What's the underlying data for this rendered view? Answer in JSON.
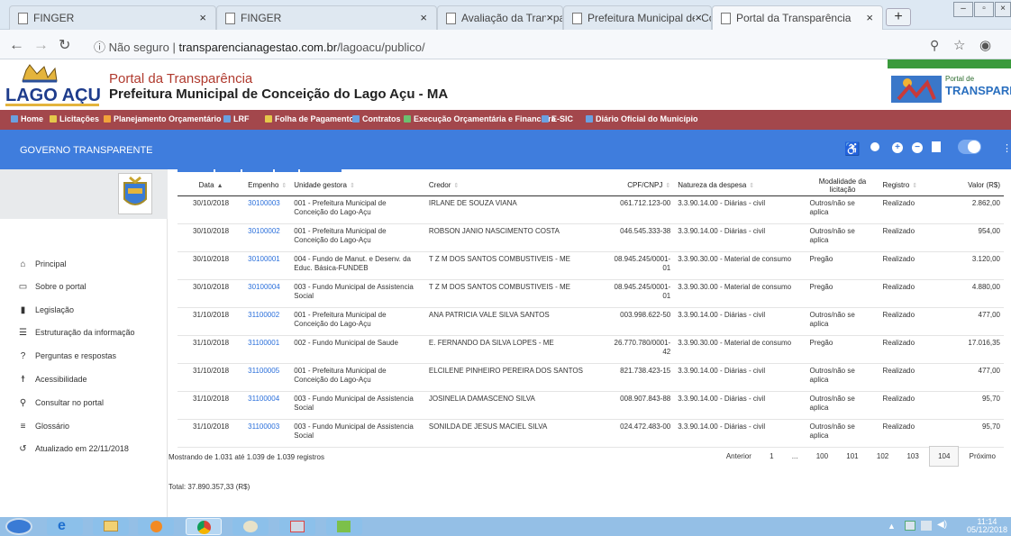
{
  "browser": {
    "tabs": [
      {
        "title": "FINGER"
      },
      {
        "title": "FINGER"
      },
      {
        "title": "Avaliação da Transparência dos"
      },
      {
        "title": "Prefeitura Municipal de Concei"
      },
      {
        "title": "Portal da Transparência"
      }
    ],
    "security": "Não seguro",
    "url_host": "transparencianagestao.com.br",
    "url_path": "/lagoacu/publico/"
  },
  "header": {
    "logo_text": "LAGO AÇU",
    "title": "Portal da Transparência",
    "subtitle": "Prefeitura Municipal de Conceição do Lago Açu - MA",
    "right_logo_small": "Portal de",
    "right_logo_big": "TRANSPARÊNC"
  },
  "menu": [
    {
      "label": "Home",
      "color": "#6aa0e0"
    },
    {
      "label": "Licitações",
      "color": "#e5c84a"
    },
    {
      "label": "Planejamento Orçamentário",
      "color": "#f2a33a"
    },
    {
      "label": "LRF",
      "color": "#6aa0e0"
    },
    {
      "label": "Folha de Pagamento",
      "color": "#e5c84a"
    },
    {
      "label": "Contratos",
      "color": "#6aa0e0"
    },
    {
      "label": "Execução Orçamentária e Financeira",
      "color": "#6cc070"
    },
    {
      "label": "E-SIC",
      "color": "#6aa0e0"
    },
    {
      "label": "Diário Oficial do Município",
      "color": "#6aa0e0"
    }
  ],
  "topbar": {
    "label": "GOVERNO TRANSPARENTE"
  },
  "sidebar": {
    "items": [
      {
        "label": "Principal",
        "icon": "home-icon"
      },
      {
        "label": "Sobre o portal",
        "icon": "folder-icon"
      },
      {
        "label": "Legislação",
        "icon": "document-icon"
      },
      {
        "label": "Estruturação da informação",
        "icon": "list-icon"
      },
      {
        "label": "Perguntas e respostas",
        "icon": "question-icon"
      },
      {
        "label": "Acessibilidade",
        "icon": "accessibility-icon"
      },
      {
        "label": "Consultar no portal",
        "icon": "search-icon"
      },
      {
        "label": "Glossário",
        "icon": "glossary-icon"
      },
      {
        "label": "Atualizado em 22/11/2018",
        "icon": "history-icon"
      }
    ]
  },
  "table": {
    "headers": [
      "Data",
      "Empenho",
      "Unidade gestora",
      "Credor",
      "CPF/CNPJ",
      "Natureza da despesa",
      "Modalidade da licitação",
      "Registro",
      "Valor (R$)"
    ],
    "rows": [
      [
        "30/10/2018",
        "30100003",
        "001 - Prefeitura Municipal de Conceição do Lago-Açu",
        "IRLANE DE SOUZA VIANA",
        "061.712.123-00",
        "3.3.90.14.00 - Diárias - civil",
        "Outros/não se aplica",
        "Realizado",
        "2.862,00"
      ],
      [
        "30/10/2018",
        "30100002",
        "001 - Prefeitura Municipal de Conceição do Lago-Açu",
        "ROBSON JANIO NASCIMENTO COSTA",
        "046.545.333-38",
        "3.3.90.14.00 - Diárias - civil",
        "Outros/não se aplica",
        "Realizado",
        "954,00"
      ],
      [
        "30/10/2018",
        "30100001",
        "004 - Fundo de Manut. e Desenv. da Educ. Básica-FUNDEB",
        "T Z M DOS SANTOS COMBUSTIVEIS - ME",
        "08.945.245/0001-01",
        "3.3.90.30.00 - Material de consumo",
        "Pregão",
        "Realizado",
        "3.120,00"
      ],
      [
        "30/10/2018",
        "30100004",
        "003 - Fundo Municipal de Assistencia Social",
        "T Z M DOS SANTOS COMBUSTIVEIS - ME",
        "08.945.245/0001-01",
        "3.3.90.30.00 - Material de consumo",
        "Pregão",
        "Realizado",
        "4.880,00"
      ],
      [
        "31/10/2018",
        "31100002",
        "001 - Prefeitura Municipal de Conceição do Lago-Açu",
        "ANA PATRICIA VALE SILVA SANTOS",
        "003.998.622-50",
        "3.3.90.14.00 - Diárias - civil",
        "Outros/não se aplica",
        "Realizado",
        "477,00"
      ],
      [
        "31/10/2018",
        "31100001",
        "002 - Fundo Municipal de Saude",
        "E. FERNANDO DA SILVA LOPES - ME",
        "26.770.780/0001-42",
        "3.3.90.30.00 - Material de consumo",
        "Pregão",
        "Realizado",
        "17.016,35"
      ],
      [
        "31/10/2018",
        "31100005",
        "001 - Prefeitura Municipal de Conceição do Lago-Açu",
        "ELCILENE PINHEIRO PEREIRA DOS SANTOS",
        "821.738.423-15",
        "3.3.90.14.00 - Diárias - civil",
        "Outros/não se aplica",
        "Realizado",
        "477,00"
      ],
      [
        "31/10/2018",
        "31100004",
        "003 - Fundo Municipal de Assistencia Social",
        "JOSINELIA DAMASCENO SILVA",
        "008.907.843-88",
        "3.3.90.14.00 - Diárias - civil",
        "Outros/não se aplica",
        "Realizado",
        "95,70"
      ],
      [
        "31/10/2018",
        "31100003",
        "003 - Fundo Municipal de Assistencia Social",
        "SONILDA DE JESUS MACIEL SILVA",
        "024.472.483-00",
        "3.3.90.14.00 - Diárias - civil",
        "Outros/não se aplica",
        "Realizado",
        "95,70"
      ]
    ]
  },
  "info": "Mostrando de 1.031 até 1.039 de 1.039 registros",
  "pagination": {
    "prev": "Anterior",
    "pages": [
      "1",
      "...",
      "100",
      "101",
      "102",
      "103",
      "104"
    ],
    "current": "104",
    "next": "Próximo"
  },
  "total": "Total: 37.890.357,33 (R$)",
  "taskbar": {
    "time": "11:14",
    "date": "05/12/2018"
  }
}
